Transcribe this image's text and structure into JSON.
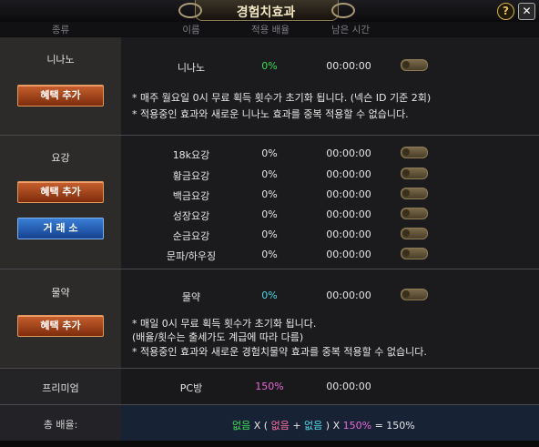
{
  "window": {
    "title": "경험치효과",
    "help_label": "?",
    "close_label": "✕"
  },
  "headers": {
    "category": "종류",
    "name": "이름",
    "rate": "적용 배율",
    "time": "남은 시간"
  },
  "sections": {
    "ninano": {
      "category": "니나노",
      "button": "혜택 추가",
      "rows": [
        {
          "name": "니나노",
          "rate": "0%",
          "time": "00:00:00"
        }
      ],
      "notes": [
        "* 매주 월요일 0시 무료 획득 횟수가 초기화 됩니다. (넥슨 ID 기준 2회)",
        "* 적용중인 효과와 새로운 니나노 효과를 중복 적용할 수 없습니다."
      ]
    },
    "yogang": {
      "category": "요강",
      "button": "혜택 추가",
      "trade_button": "거 래 소",
      "rows": [
        {
          "name": "18k요강",
          "rate": "0%",
          "time": "00:00:00"
        },
        {
          "name": "황금요강",
          "rate": "0%",
          "time": "00:00:00"
        },
        {
          "name": "백금요강",
          "rate": "0%",
          "time": "00:00:00"
        },
        {
          "name": "성장요강",
          "rate": "0%",
          "time": "00:00:00"
        },
        {
          "name": "순금요강",
          "rate": "0%",
          "time": "00:00:00"
        },
        {
          "name": "문파/하우징",
          "rate": "0%",
          "time": "00:00:00"
        }
      ]
    },
    "potion": {
      "category": "물약",
      "button": "혜택 추가",
      "rows": [
        {
          "name": "물약",
          "rate": "0%",
          "time": "00:00:00"
        }
      ],
      "notes": [
        "* 매일 0시 무료 획득 횟수가 초기화 됩니다.",
        "(배율/횟수는 출세가도 계급에 따라 다름)",
        "* 적용중인 효과와 새로운 경험치물약 효과를 중복 적용할 수 없습니다."
      ]
    },
    "premium": {
      "category": "프리미엄",
      "rows": [
        {
          "name": "PC방",
          "rate": "150%",
          "time": "00:00:00"
        }
      ]
    }
  },
  "total": {
    "label": "총 배율:",
    "formula": {
      "a": "없음",
      "x1": "X (",
      "b": "없음",
      "plus": "+",
      "c": "없음",
      "x2": ") X",
      "d": "150%",
      "eq": "=",
      "result": "150%"
    }
  },
  "colors": {
    "green": "#3ddc5a",
    "cyan": "#4fd8e8",
    "magenta": "#e86ad8",
    "pink": "#ff6fa0",
    "brown_button": "#b0521f",
    "blue_button": "#2a63c0"
  }
}
